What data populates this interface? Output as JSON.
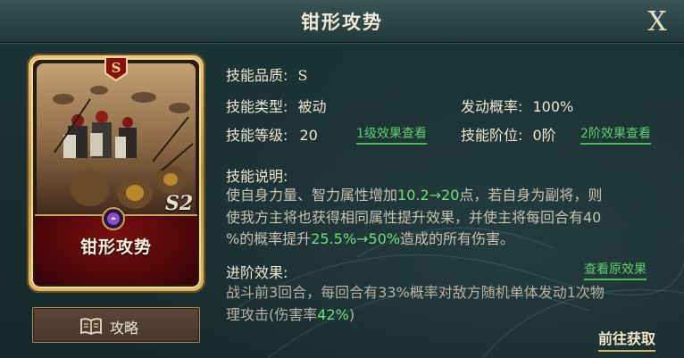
{
  "window": {
    "title": "钳形攻势",
    "close_label": "X"
  },
  "card": {
    "rank": "S",
    "season_mark": "S2",
    "name": "钳形攻势"
  },
  "guide_button": {
    "label": "攻略",
    "icon": "book-icon"
  },
  "skill": {
    "quality_label": "技能品质:",
    "quality_value": "S",
    "type_label": "技能类型:",
    "type_value": "被动",
    "trigger_label": "发动概率:",
    "trigger_value": "100%",
    "level_label": "技能等级:",
    "level_value": "20",
    "level_link": "1级效果查看",
    "tier_label": "技能阶位:",
    "tier_value": "0阶",
    "tier_link": "2阶效果查看"
  },
  "description": {
    "heading": "技能说明:",
    "line1_a": "使自身力量、智力属性增加",
    "line1_hl": "10.2→20",
    "line1_b": "点，若自身为副将，则",
    "line2": "使我方主将也获得相同属性提升效果，并使主将每回合有40",
    "line3_a": "%的概率提升",
    "line3_hl": "25.5%→50%",
    "line3_b": "造成的所有伤害。"
  },
  "advanced": {
    "heading": "进阶效果:",
    "view_link": "查看原效果",
    "line1": "战斗前3回合，每回合有33%概率对敌方随机单体发动1次物",
    "line2_a": "理攻击(伤害率",
    "line2_hl": "42%",
    "line2_b": ")"
  },
  "goto_link": "前往获取",
  "colors": {
    "highlight": "#6fe07c",
    "link": "#5fd06b",
    "banner": "#7a1010",
    "frame_gold": "#d8b866"
  }
}
